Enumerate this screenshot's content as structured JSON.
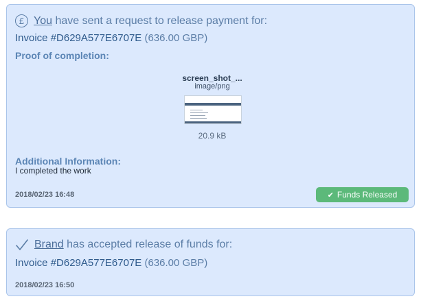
{
  "card1": {
    "header_link": "You",
    "header_rest": " have sent a request to release payment for:",
    "invoice_number": "Invoice #D629A577E6707E",
    "invoice_amount": " (636.00 GBP)",
    "proof_label": "Proof of completion:",
    "file": {
      "name": "screen_shot_...",
      "type": "image/png",
      "size": "20.9 kB"
    },
    "additional_label": "Additional Information:",
    "additional_text": "I completed the work",
    "timestamp": "2018/02/23 16:48",
    "badge_label": "Funds Released",
    "icon": "pound-circle-icon"
  },
  "card2": {
    "header_link": "Brand",
    "header_rest": " has accepted release of funds for:",
    "invoice_number": "Invoice #D629A577E6707E",
    "invoice_amount": " (636.00 GBP)",
    "timestamp": "2018/02/23 16:50",
    "icon": "checkmark-icon"
  },
  "colors": {
    "card_bg": "#dce9fd",
    "card_border": "#a9c4ea",
    "badge_green": "#5cb97a",
    "link": "#4a6d99"
  }
}
